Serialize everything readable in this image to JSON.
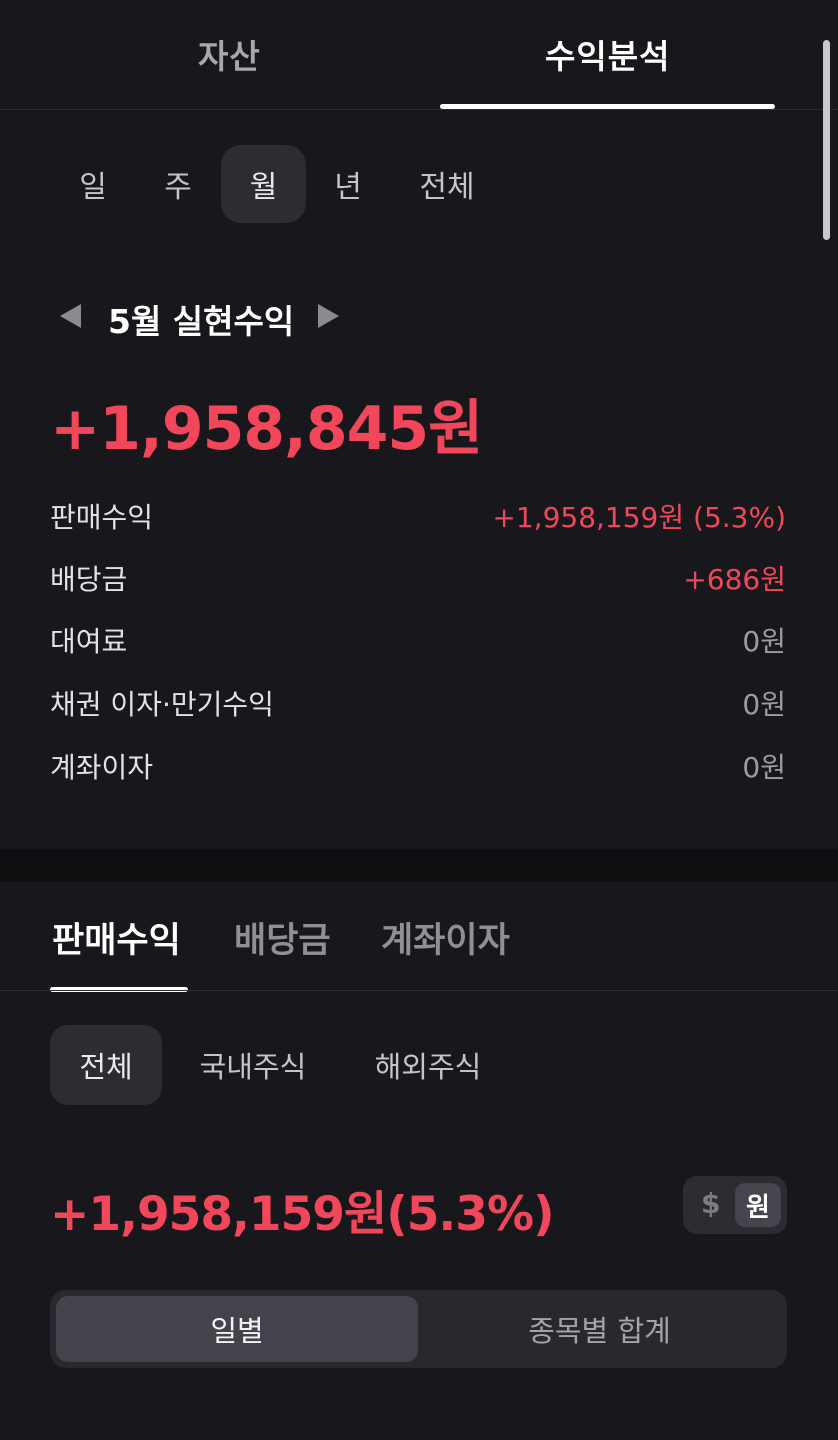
{
  "top_tabs": {
    "assets": "자산",
    "analysis": "수익분석",
    "active": "analysis"
  },
  "period": {
    "items": [
      "일",
      "주",
      "월",
      "년",
      "전체"
    ],
    "selected": "월"
  },
  "month_title": "5월 실현수익",
  "total_amount": "+1,958,845원",
  "breakdown": [
    {
      "label": "판매수익",
      "value": "+1,958,159원 (5.3%)",
      "positive": true
    },
    {
      "label": "배당금",
      "value": "+686원",
      "positive": true
    },
    {
      "label": "대여료",
      "value": "0원",
      "positive": false
    },
    {
      "label": "채권 이자·만기수익",
      "value": "0원",
      "positive": false
    },
    {
      "label": "계좌이자",
      "value": "0원",
      "positive": false
    }
  ],
  "sub_tabs": {
    "items": [
      "판매수익",
      "배당금",
      "계좌이자"
    ],
    "selected": "판매수익"
  },
  "market_filter": {
    "items": [
      "전체",
      "국내주식",
      "해외주식"
    ],
    "selected": "전체"
  },
  "sale_amount": "+1,958,159원(5.3%)",
  "currency": {
    "usd": "$",
    "krw": "원",
    "selected": "원"
  },
  "view_mode": {
    "daily": "일별",
    "by_stock": "종목별 합계",
    "selected": "일별"
  },
  "colors": {
    "accent_red": "#f2475b",
    "background": "#17171c"
  }
}
